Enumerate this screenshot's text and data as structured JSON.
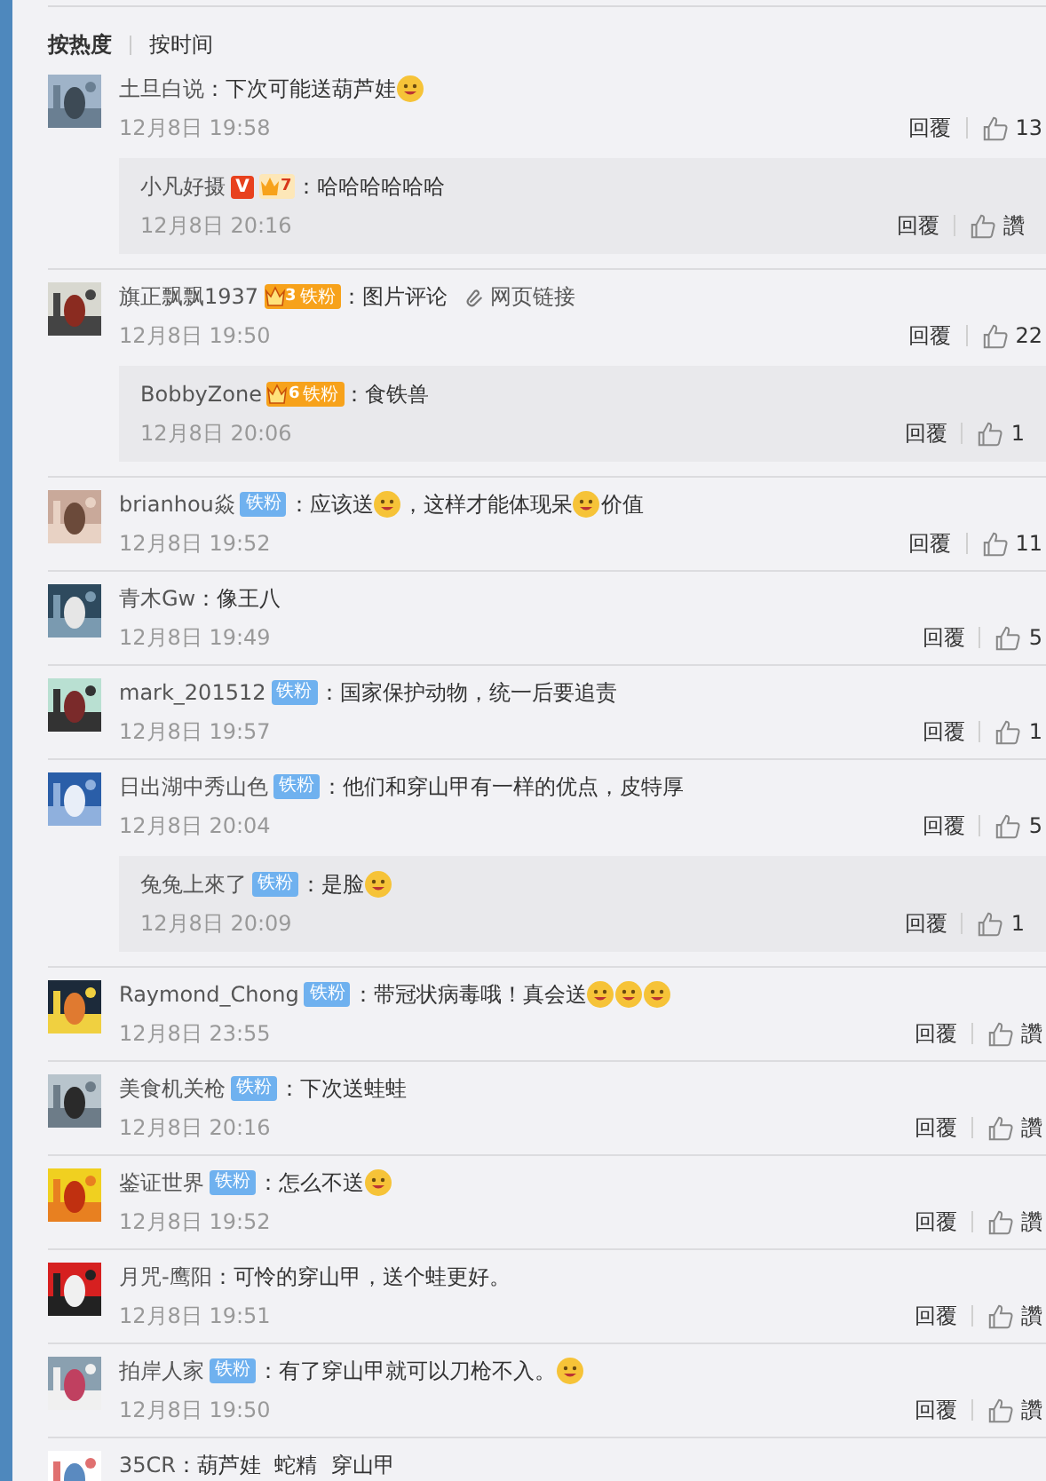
{
  "sort_tabs": [
    {
      "label": "按热度",
      "selected": true
    },
    {
      "label": "按时间",
      "selected": false
    }
  ],
  "comments": [
    {
      "name": "土旦白说",
      "segments": [
        {
          "kind": "text",
          "text": "：下次可能送葫芦娃"
        },
        {
          "kind": "emoji"
        }
      ],
      "time": "12月8日 19:58",
      "reply_label": "回覆",
      "likes": "13",
      "replies": [
        {
          "name": "小凡好摄",
          "badges": [
            {
              "kind": "vip",
              "text": "V"
            },
            {
              "kind": "crown",
              "level": "7"
            }
          ],
          "segments": [
            {
              "kind": "text",
              "text": "：哈哈哈哈哈哈"
            }
          ],
          "time": "12月8日 20:16",
          "reply_label": "回覆",
          "likes": "讚"
        }
      ]
    },
    {
      "name": "旗正飘飘1937",
      "badges": [
        {
          "kind": "crown-fan",
          "level": "3",
          "text": "铁粉"
        }
      ],
      "segments": [
        {
          "kind": "text",
          "text": "：图片评论"
        }
      ],
      "link": "网页链接",
      "time": "12月8日 19:50",
      "reply_label": "回覆",
      "likes": "22",
      "replies": [
        {
          "name": "BobbyZone",
          "badges": [
            {
              "kind": "crown-fan",
              "level": "6",
              "text": "铁粉"
            }
          ],
          "segments": [
            {
              "kind": "text",
              "text": "：食铁兽"
            }
          ],
          "time": "12月8日 20:06",
          "reply_label": "回覆",
          "likes": "1"
        }
      ]
    },
    {
      "name": "brianhou焱",
      "badges": [
        {
          "kind": "fan",
          "text": "铁粉"
        }
      ],
      "segments": [
        {
          "kind": "text",
          "text": "：应该送"
        },
        {
          "kind": "emoji"
        },
        {
          "kind": "text",
          "text": "，这样才能体现呆"
        },
        {
          "kind": "emoji"
        },
        {
          "kind": "text",
          "text": "价值"
        }
      ],
      "time": "12月8日 19:52",
      "reply_label": "回覆",
      "likes": "11"
    },
    {
      "name": "青木Gw",
      "segments": [
        {
          "kind": "text",
          "text": "：像王八"
        }
      ],
      "time": "12月8日 19:49",
      "reply_label": "回覆",
      "likes": "5"
    },
    {
      "name": "mark_201512",
      "badges": [
        {
          "kind": "fan",
          "text": "铁粉"
        }
      ],
      "segments": [
        {
          "kind": "text",
          "text": "：国家保护动物，统一后要追责"
        }
      ],
      "time": "12月8日 19:57",
      "reply_label": "回覆",
      "likes": "1"
    },
    {
      "name": "日出湖中秀山色",
      "badges": [
        {
          "kind": "fan",
          "text": "铁粉"
        }
      ],
      "segments": [
        {
          "kind": "text",
          "text": "：他们和穿山甲有一样的优点，皮特厚"
        }
      ],
      "time": "12月8日 20:04",
      "reply_label": "回覆",
      "likes": "5",
      "replies": [
        {
          "name": "兔兔上來了",
          "badges": [
            {
              "kind": "fan",
              "text": "铁粉"
            }
          ],
          "segments": [
            {
              "kind": "text",
              "text": "：是脸"
            },
            {
              "kind": "emoji"
            }
          ],
          "time": "12月8日 20:09",
          "reply_label": "回覆",
          "likes": "1"
        }
      ]
    },
    {
      "name": "Raymond_Chong",
      "badges": [
        {
          "kind": "fan",
          "text": "铁粉"
        }
      ],
      "segments": [
        {
          "kind": "text",
          "text": "：带冠状病毒哦！真会送"
        },
        {
          "kind": "emoji"
        },
        {
          "kind": "emoji"
        },
        {
          "kind": "emoji"
        }
      ],
      "time": "12月8日 23:55",
      "reply_label": "回覆",
      "likes": "讚"
    },
    {
      "name": "美食机关枪",
      "badges": [
        {
          "kind": "fan",
          "text": "铁粉"
        }
      ],
      "segments": [
        {
          "kind": "text",
          "text": "：下次送蛙蛙"
        }
      ],
      "time": "12月8日 20:16",
      "reply_label": "回覆",
      "likes": "讚"
    },
    {
      "name": "鉴证世界",
      "badges": [
        {
          "kind": "fan",
          "text": "铁粉"
        }
      ],
      "segments": [
        {
          "kind": "text",
          "text": "：怎么不送"
        },
        {
          "kind": "emoji"
        }
      ],
      "time": "12月8日 19:52",
      "reply_label": "回覆",
      "likes": "讚"
    },
    {
      "name": "月咒-鹰阳",
      "segments": [
        {
          "kind": "text",
          "text": "：可怜的穿山甲，送个蛙更好。"
        }
      ],
      "time": "12月8日 19:51",
      "reply_label": "回覆",
      "likes": "讚"
    },
    {
      "name": "拍岸人家",
      "badges": [
        {
          "kind": "fan",
          "text": "铁粉"
        }
      ],
      "segments": [
        {
          "kind": "text",
          "text": "：有了穿山甲就可以刀枪不入。"
        },
        {
          "kind": "emoji"
        }
      ],
      "time": "12月8日 19:50",
      "reply_label": "回覆",
      "likes": "讚"
    },
    {
      "name": "35CR",
      "segments": [
        {
          "kind": "text",
          "text": "：葫芦娃  蛇精  穿山甲"
        }
      ]
    }
  ]
}
